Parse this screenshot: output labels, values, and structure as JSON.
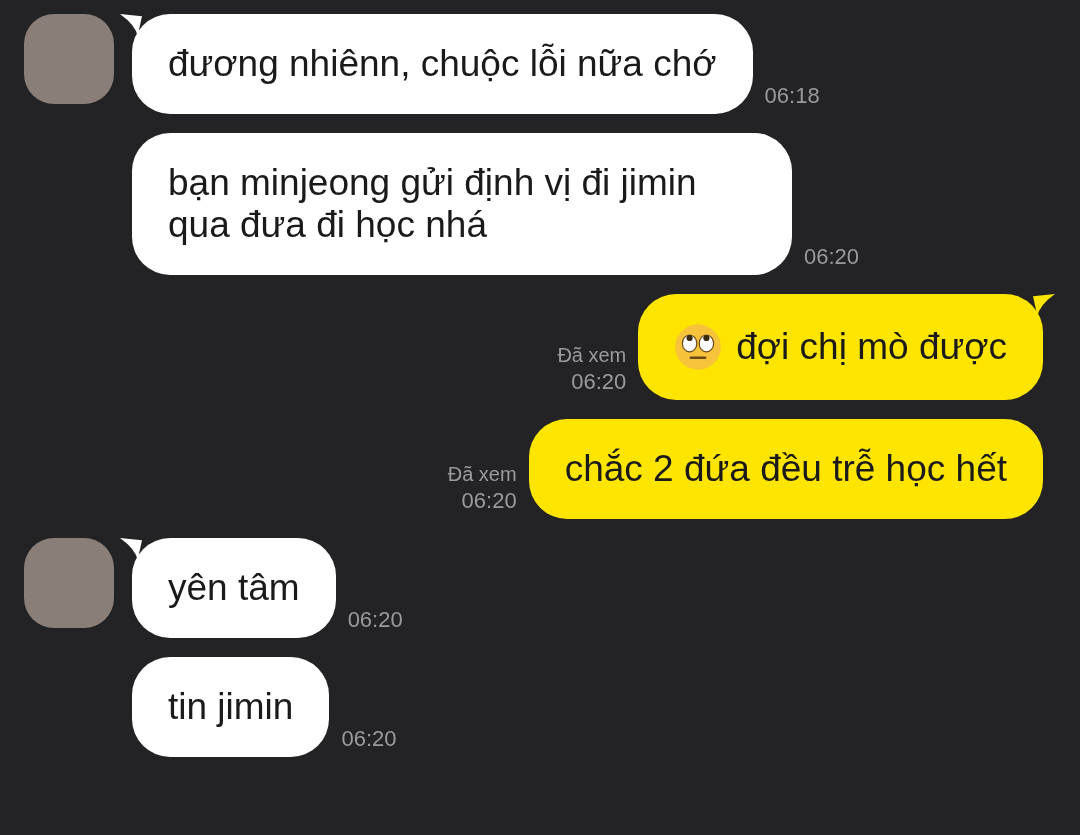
{
  "messages": [
    {
      "kind": "incoming",
      "show_avatar": true,
      "text": "đương nhiênn, chuộc lỗi nữa chớ",
      "time": "06:18"
    },
    {
      "kind": "incoming",
      "show_avatar": false,
      "text": "bạn minjeong gửi định vị đi jimin qua đưa đi học nhá",
      "time": "06:20"
    },
    {
      "kind": "outgoing",
      "show_tail": true,
      "eye_roll_emoji": true,
      "text": "đợi chị mò được",
      "read_label": "Đã xem",
      "time": "06:20"
    },
    {
      "kind": "outgoing",
      "show_tail": false,
      "text": "chắc 2 đứa đều trễ học hết",
      "read_label": "Đã xem",
      "time": "06:20"
    },
    {
      "kind": "incoming",
      "show_avatar": true,
      "text": "yên tâm",
      "time": "06:20"
    },
    {
      "kind": "incoming",
      "show_avatar": false,
      "text": "tin jimin",
      "time": "06:20"
    }
  ]
}
